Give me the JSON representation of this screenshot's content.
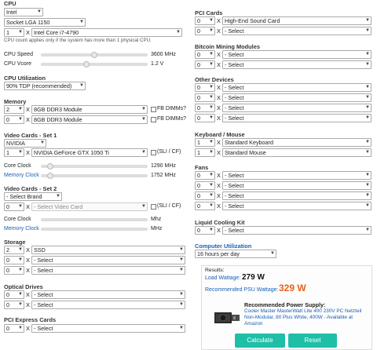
{
  "left": {
    "cpu": {
      "title": "CPU",
      "brand": "Intel",
      "socket": "Socket LGA 1150",
      "qty": "1",
      "model": "Intel Core i7-4790",
      "note": "CPU count applies only if the system has more than 1 physical CPU.",
      "speed_label": "CPU Speed",
      "speed_value": "3600 MHz",
      "vcore_label": "CPU Vcore",
      "vcore_value": "1.2 V"
    },
    "util": {
      "title": "CPU Utilization",
      "value": "90% TDP (recommended)"
    },
    "memory": {
      "title": "Memory",
      "rows": [
        {
          "qty": "2",
          "module": "8GB DDR3 Module"
        },
        {
          "qty": "0",
          "module": "8GB DDR3 Module"
        }
      ],
      "fb_label": "FB DIMMs?"
    },
    "video1": {
      "title": "Video Cards - Set 1",
      "brand": "NVIDIA",
      "qty": "1",
      "model": "NVIDIA GeForce GTX 1050 Ti",
      "sli": "(SLI / CF)",
      "core_label": "Core Clock",
      "core_value": "1290 MHz",
      "mem_label": "Memory Clock",
      "mem_value": "1752 MHz"
    },
    "video2": {
      "title": "Video Cards - Set 2",
      "brand": "- Select Brand",
      "qty": "0",
      "model": "- Select Video Card",
      "sli": "(SLI / CF)",
      "core_label": "Core Clock",
      "core_value": "Mhz",
      "mem_label": "Memory Clock",
      "mem_value": "MHz"
    },
    "storage": {
      "title": "Storage",
      "rows": [
        {
          "qty": "2",
          "item": "SSD"
        },
        {
          "qty": "0",
          "item": "- Select"
        },
        {
          "qty": "0",
          "item": "- Select"
        }
      ]
    },
    "optical": {
      "title": "Optical Drives",
      "rows": [
        {
          "qty": "0",
          "item": "- Select"
        },
        {
          "qty": "0",
          "item": "- Select"
        }
      ]
    },
    "pcie": {
      "title": "PCI Express Cards",
      "rows": [
        {
          "qty": "0",
          "item": "- Select"
        }
      ]
    }
  },
  "right": {
    "pci": {
      "title": "PCI Cards",
      "rows": [
        {
          "qty": "0",
          "item": "High-End Sound Card"
        },
        {
          "qty": "0",
          "item": "- Select"
        }
      ]
    },
    "bitcoin": {
      "title": "Bitcoin Mining Modules",
      "rows": [
        {
          "qty": "0",
          "item": "- Select"
        },
        {
          "qty": "0",
          "item": "- Select"
        }
      ]
    },
    "other": {
      "title": "Other Devices",
      "rows": [
        {
          "qty": "0",
          "item": "- Select"
        },
        {
          "qty": "0",
          "item": "- Select"
        },
        {
          "qty": "0",
          "item": "- Select"
        },
        {
          "qty": "0",
          "item": "- Select"
        }
      ]
    },
    "keyboard": {
      "title": "Keyboard / Mouse",
      "rows": [
        {
          "qty": "1",
          "item": "Standard Keyboard"
        },
        {
          "qty": "1",
          "item": "Standard Mouse"
        }
      ]
    },
    "fans": {
      "title": "Fans",
      "rows": [
        {
          "qty": "0",
          "item": "- Select"
        },
        {
          "qty": "0",
          "item": "- Select"
        },
        {
          "qty": "0",
          "item": "- Select"
        },
        {
          "qty": "0",
          "item": "- Select"
        }
      ]
    },
    "liquid": {
      "title": "Liquid Cooling Kit",
      "rows": [
        {
          "qty": "0",
          "item": "- Select"
        }
      ]
    },
    "computer_util": {
      "title": "Computer Utilization",
      "value": "16 hours per day"
    }
  },
  "results": {
    "title": "Results:",
    "load_label": "Load Wattage:",
    "load_value": "279 W",
    "psu_label": "Recommended PSU Wattage:",
    "psu_value": "329 W",
    "rec_title": "Recommended Power Supply:",
    "rec_text": "Cooler Master MasterWatt Lite 400 230V PC Netzteil Non-Modular, 80 Plus White, 400W - Available at Amazon",
    "calculate": "Calculate",
    "reset": "Reset"
  },
  "x_sym": "X",
  "colors": {
    "accent": "#1fbfa7",
    "psu_value": "#e8611a",
    "link": "#1a5fb4"
  }
}
